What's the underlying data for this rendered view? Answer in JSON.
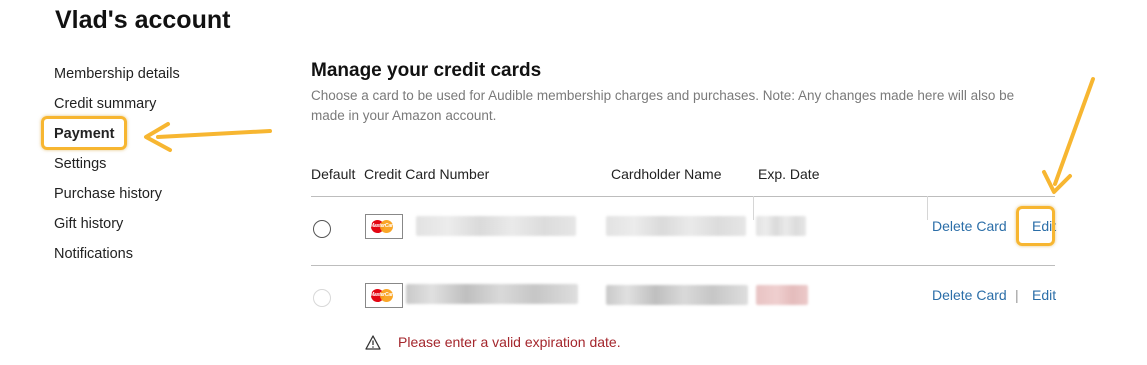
{
  "account": {
    "title": "Vlad's account"
  },
  "sidebar": {
    "items": [
      {
        "label": "Membership details"
      },
      {
        "label": "Credit summary"
      },
      {
        "label": "Payment",
        "active": true
      },
      {
        "label": "Settings"
      },
      {
        "label": "Purchase history"
      },
      {
        "label": "Gift history"
      },
      {
        "label": "Notifications"
      }
    ]
  },
  "main": {
    "title": "Manage your credit cards",
    "description": "Choose a card to be used for Audible membership charges and purchases. Note: Any changes made here will also be made in your Amazon account.",
    "table": {
      "headers": [
        "Default",
        "Credit Card Number",
        "Cardholder Name",
        "Exp. Date"
      ],
      "rows": [
        {
          "card_brand": "MasterCard",
          "delete_label": "Delete Card",
          "edit_label": "Edit"
        },
        {
          "card_brand": "MasterCard",
          "delete_label": "Delete Card",
          "separator": "|",
          "edit_label": "Edit"
        }
      ]
    },
    "error": {
      "icon": "warning-icon",
      "text": "Please enter a valid expiration date."
    }
  },
  "annotations": {
    "highlight_color": "#f7b631"
  },
  "colors": {
    "link": "#2b6ea8",
    "error": "#a4262c"
  }
}
